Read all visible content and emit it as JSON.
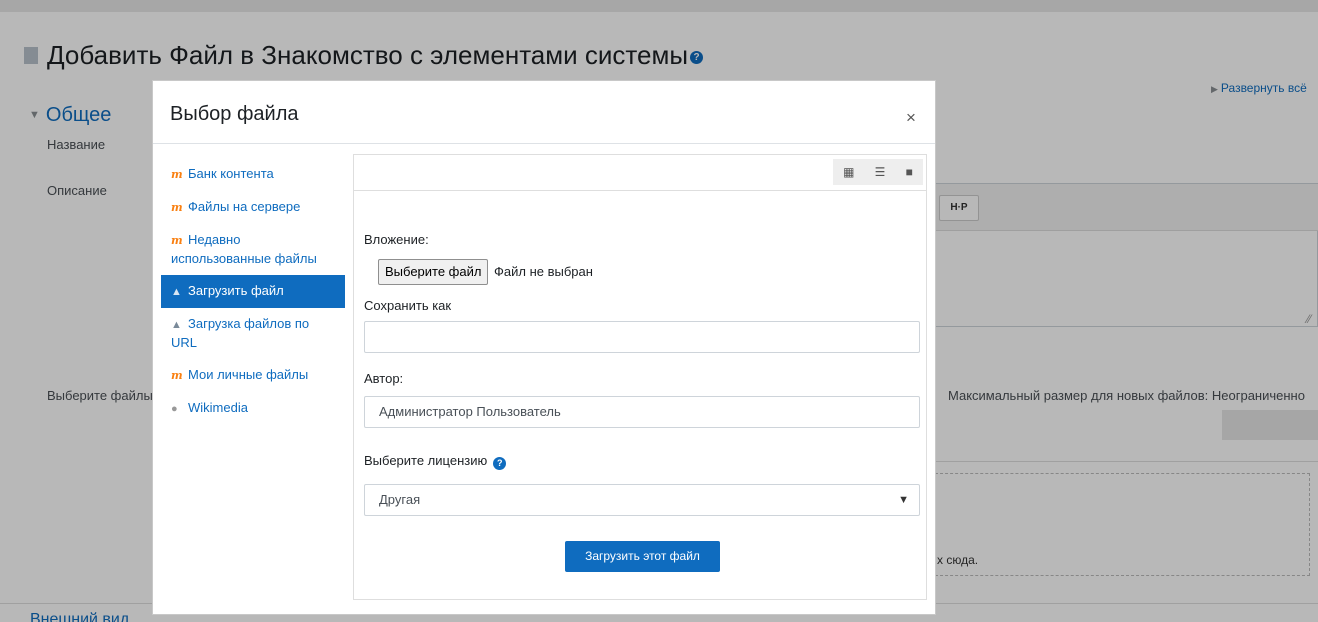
{
  "page": {
    "title": "Добавить Файл в Знакомство с элементами системы",
    "title_help": "?",
    "expand_all": "Развернуть всё",
    "section_general": "Общее",
    "label_name": "Название",
    "label_description": "Описание",
    "label_select_files": "Выберите файлы",
    "editor_h5p": "H·P",
    "max_size_text": "Максимальный размер для новых файлов: Неограниченно",
    "drop_text": "х сюда.",
    "next_section": "Внешний вид"
  },
  "modal": {
    "title": "Выбор файла",
    "close": "×",
    "repositories": [
      {
        "label": "Банк контента",
        "icon": "moodle-icon",
        "active": false
      },
      {
        "label": "Файлы на сервере",
        "icon": "moodle-icon",
        "active": false
      },
      {
        "label": "Недавно использованные файлы",
        "icon": "moodle-icon",
        "active": false
      },
      {
        "label": "Загрузить файл",
        "icon": "upload-icon",
        "active": true
      },
      {
        "label": "Загрузка файлов по URL",
        "icon": "url-download-icon",
        "active": false
      },
      {
        "label": "Мои личные файлы",
        "icon": "moodle-icon",
        "active": false
      },
      {
        "label": "Wikimedia",
        "icon": "wikimedia-icon",
        "active": false
      }
    ],
    "view_icons": [
      "grid-view-icon",
      "list-view-icon",
      "folder-view-icon"
    ],
    "form": {
      "attachment_label": "Вложение:",
      "choose_file_button": "Выберите файл",
      "file_status": "Файл не выбран",
      "save_as_label": "Сохранить как",
      "save_as_value": "",
      "author_label": "Автор:",
      "author_value": "Администратор Пользователь",
      "license_label": "Выберите лицензию",
      "license_value": "Другая",
      "upload_button": "Загрузить этот файл"
    }
  },
  "colors": {
    "accent": "#0f6cbf",
    "moodle_orange": "#f98012"
  }
}
